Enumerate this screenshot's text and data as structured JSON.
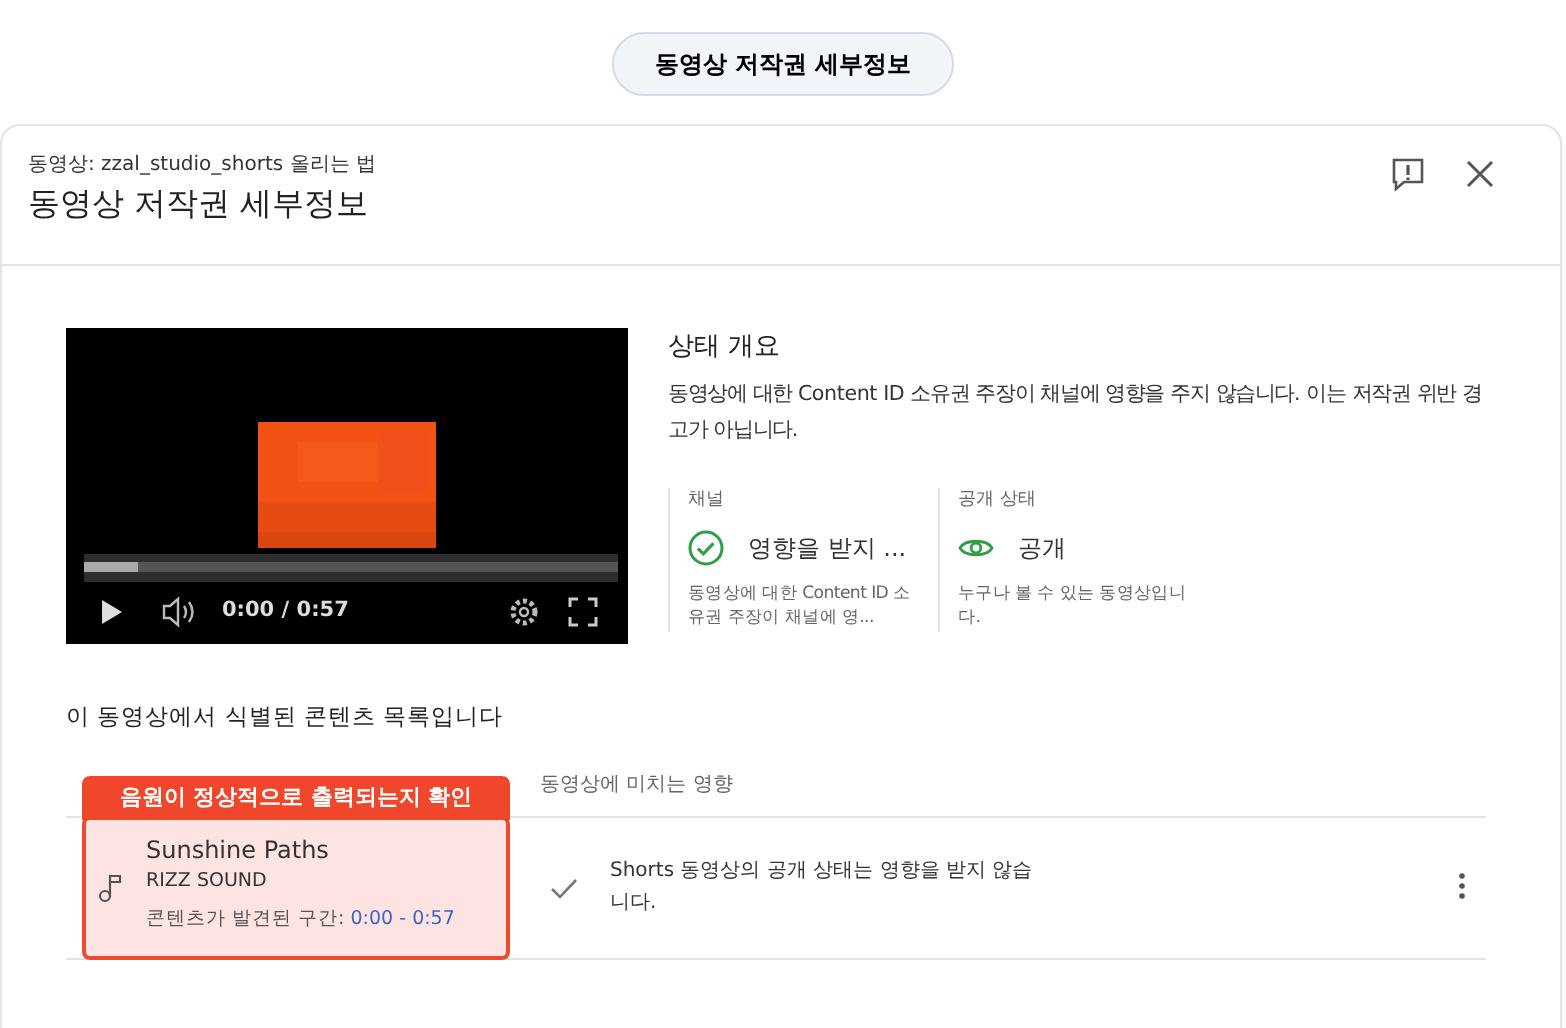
{
  "top_button": "동영상 저작권 세부정보",
  "dialog": {
    "subtitle": "동영상: zzal_studio_shorts 올리는 법",
    "title": "동영상 저작권 세부정보"
  },
  "player": {
    "time": "0:00 / 0:57",
    "level": 0.1
  },
  "status": {
    "heading": "상태 개요",
    "description": "동영상에 대한 Content ID 소유권 주장이 채널에 영향을 주지 않습니다. 이는 저작권 위반 경고가 아닙니다.",
    "cards": [
      {
        "kind": "check",
        "label": "채널",
        "value": "영향을 받지 ...",
        "note": "동영상에 대한 Content ID 소유권 주장이 채널에 영..."
      },
      {
        "kind": "eye",
        "label": "공개 상태",
        "value": "공개",
        "note": "누구나 볼 수 있는 동영상입니다."
      }
    ]
  },
  "content": {
    "heading": "이 동영상에서 식별된 콘텐츠 목록입니다",
    "impact_column": "동영상에 미치는 영향",
    "rows": [
      {
        "title": "Sunshine Paths",
        "artist": "RIZZ SOUND",
        "range_label": "콘텐츠가 발견된 구간:",
        "range": "0:00 - 0:57",
        "impact": "Shorts 동영상의 공개 상태는 영향을 받지 않습니다."
      }
    ]
  },
  "annotation": "음원이 정상적으로 출력되는지 확인"
}
